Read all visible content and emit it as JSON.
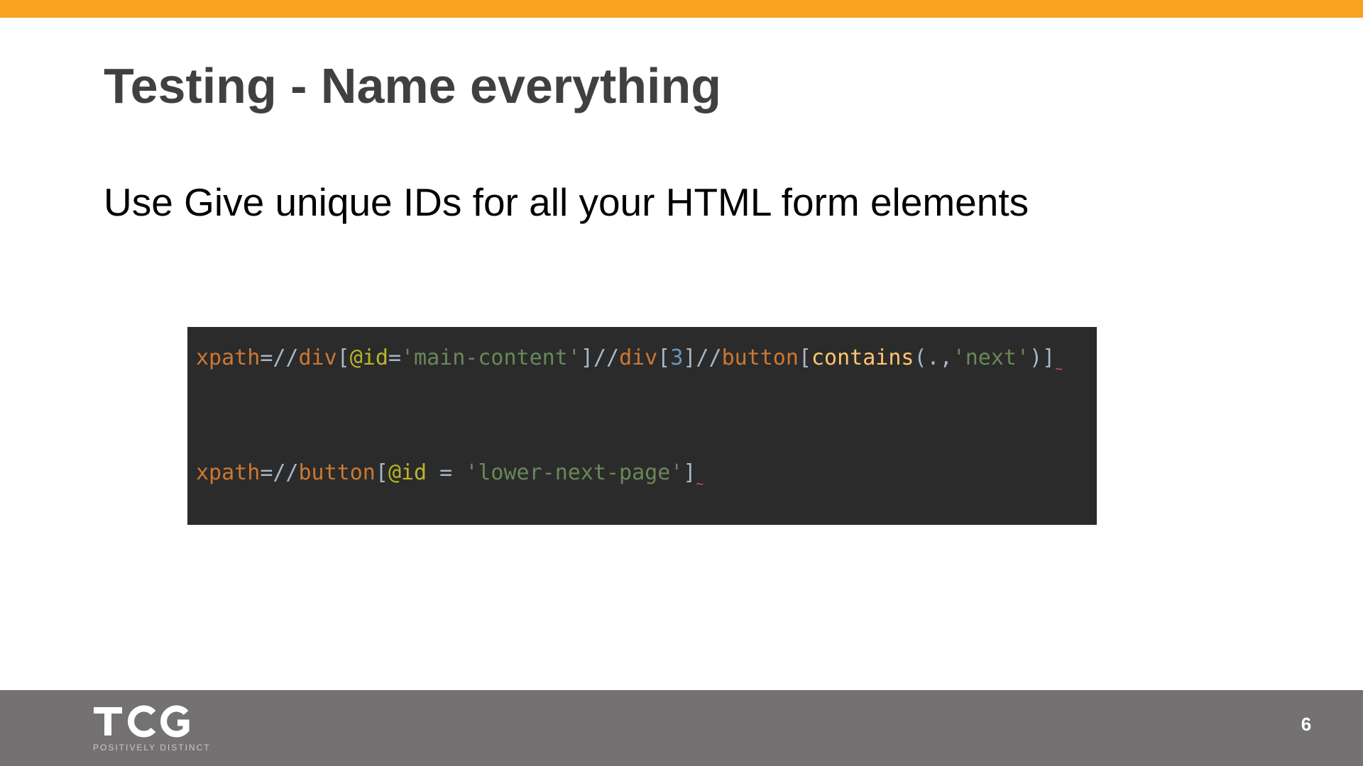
{
  "slide": {
    "title": "Testing - Name everything",
    "body": "Use Give unique IDs for all your HTML form elements",
    "page_number": "6"
  },
  "code": {
    "lines": [
      [
        {
          "text": "xpath",
          "color": "#cc7832"
        },
        {
          "text": "=//",
          "color": "#a9b7c6"
        },
        {
          "text": "div",
          "color": "#cc7832"
        },
        {
          "text": "[",
          "color": "#a9b7c6"
        },
        {
          "text": "@id",
          "color": "#bbb529"
        },
        {
          "text": "=",
          "color": "#a9b7c6"
        },
        {
          "text": "'main-content'",
          "color": "#6a8759"
        },
        {
          "text": "]//",
          "color": "#a9b7c6"
        },
        {
          "text": "div",
          "color": "#cc7832"
        },
        {
          "text": "[",
          "color": "#a9b7c6"
        },
        {
          "text": "3",
          "color": "#6897bb"
        },
        {
          "text": "]//",
          "color": "#a9b7c6"
        },
        {
          "text": "button",
          "color": "#cc7832"
        },
        {
          "text": "[",
          "color": "#a9b7c6"
        },
        {
          "text": "contains",
          "color": "#ffc66d"
        },
        {
          "text": "(.,",
          "color": "#a9b7c6"
        },
        {
          "text": "'next'",
          "color": "#6a8759"
        },
        {
          "text": ")]",
          "color": "#a9b7c6"
        }
      ],
      [
        {
          "text": "xpath",
          "color": "#cc7832"
        },
        {
          "text": "=//",
          "color": "#a9b7c6"
        },
        {
          "text": "button",
          "color": "#cc7832"
        },
        {
          "text": "[",
          "color": "#a9b7c6"
        },
        {
          "text": "@id",
          "color": "#bbb529"
        },
        {
          "text": " = ",
          "color": "#a9b7c6"
        },
        {
          "text": "'lower-next-page'",
          "color": "#6a8759"
        },
        {
          "text": "]",
          "color": "#a9b7c6"
        }
      ]
    ]
  },
  "footer": {
    "logo_text": "TCG",
    "tagline": "POSITIVELY DISTINCT"
  },
  "colors": {
    "accent": "#f9a21f",
    "title": "#404040",
    "footer": "#747172",
    "code_background": "#2b2b2b"
  }
}
